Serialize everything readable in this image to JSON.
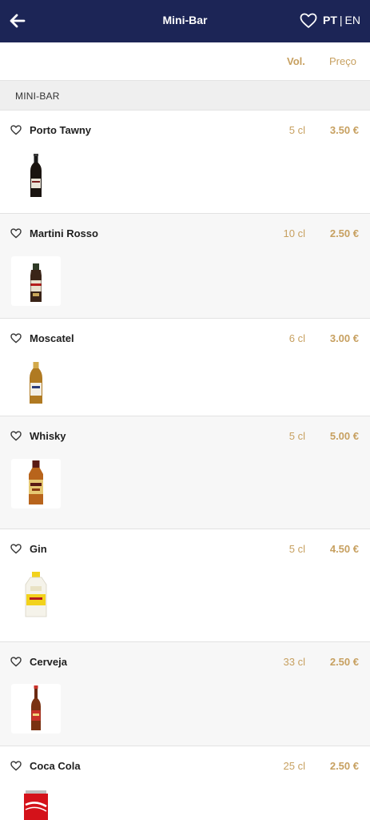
{
  "header": {
    "title": "Mini-Bar",
    "lang_pt": "PT",
    "lang_sep": "|",
    "lang_en": "EN"
  },
  "columns": {
    "volume": "Vol.",
    "price": "Preço"
  },
  "section": {
    "title": "MINI-BAR"
  },
  "items": [
    {
      "name": "Porto Tawny",
      "volume": "5 cl",
      "price": "3.50 €",
      "image": "port-wine-bottle"
    },
    {
      "name": "Martini Rosso",
      "volume": "10 cl",
      "price": "2.50 €",
      "image": "martini-bottle"
    },
    {
      "name": "Moscatel",
      "volume": "6 cl",
      "price": "3.00 €",
      "image": "moscatel-bottle"
    },
    {
      "name": "Whisky",
      "volume": "5 cl",
      "price": "5.00 €",
      "image": "whisky-bottle"
    },
    {
      "name": "Gin",
      "volume": "5 cl",
      "price": "4.50 €",
      "image": "gin-bottle"
    },
    {
      "name": "Cerveja",
      "volume": "33 cl",
      "price": "2.50 €",
      "image": "beer-bottle"
    },
    {
      "name": "Coca Cola",
      "volume": "25 cl",
      "price": "2.50 €",
      "image": "cola-can"
    }
  ],
  "colors": {
    "header_bg": "#1c2556",
    "accent_gold": "#c7a060",
    "section_bg": "#efefef"
  }
}
